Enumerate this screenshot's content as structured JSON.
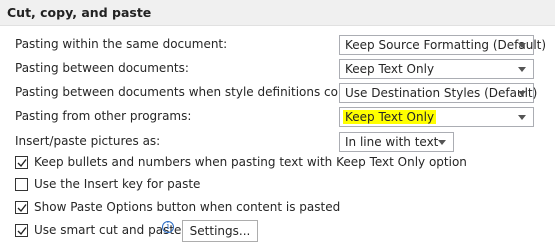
{
  "section": {
    "title": "Cut, copy, and paste"
  },
  "options": [
    {
      "label": "Pasting within the same document:",
      "value": "Keep Source Formatting (Default)"
    },
    {
      "label": "Pasting between documents:",
      "value": "Keep Text Only"
    },
    {
      "label": "Pasting between documents when style definitions conflict:",
      "value": "Use Destination Styles (Default)"
    },
    {
      "label": "Pasting from other programs:",
      "value": "Keep Text Only"
    },
    {
      "label": "Insert/paste pictures as:",
      "value": "In line with text"
    }
  ],
  "checkboxes": [
    {
      "label": "Keep bullets and numbers when pasting text with Keep Text Only option",
      "checked": true
    },
    {
      "label": "Use the Insert key for paste",
      "checked": false
    },
    {
      "label": "Show Paste Options button when content is pasted",
      "checked": true
    },
    {
      "label": "Use smart cut and paste",
      "checked": true
    }
  ],
  "buttons": {
    "settings": "Settings..."
  },
  "colors": {
    "highlight": "#ffff00",
    "header_bg": "#f0f0f0",
    "info_icon": "#2b6cc4"
  },
  "icons": {
    "info": "info-icon",
    "dropdown": "chevron-down-icon",
    "check": "checkmark-icon"
  }
}
